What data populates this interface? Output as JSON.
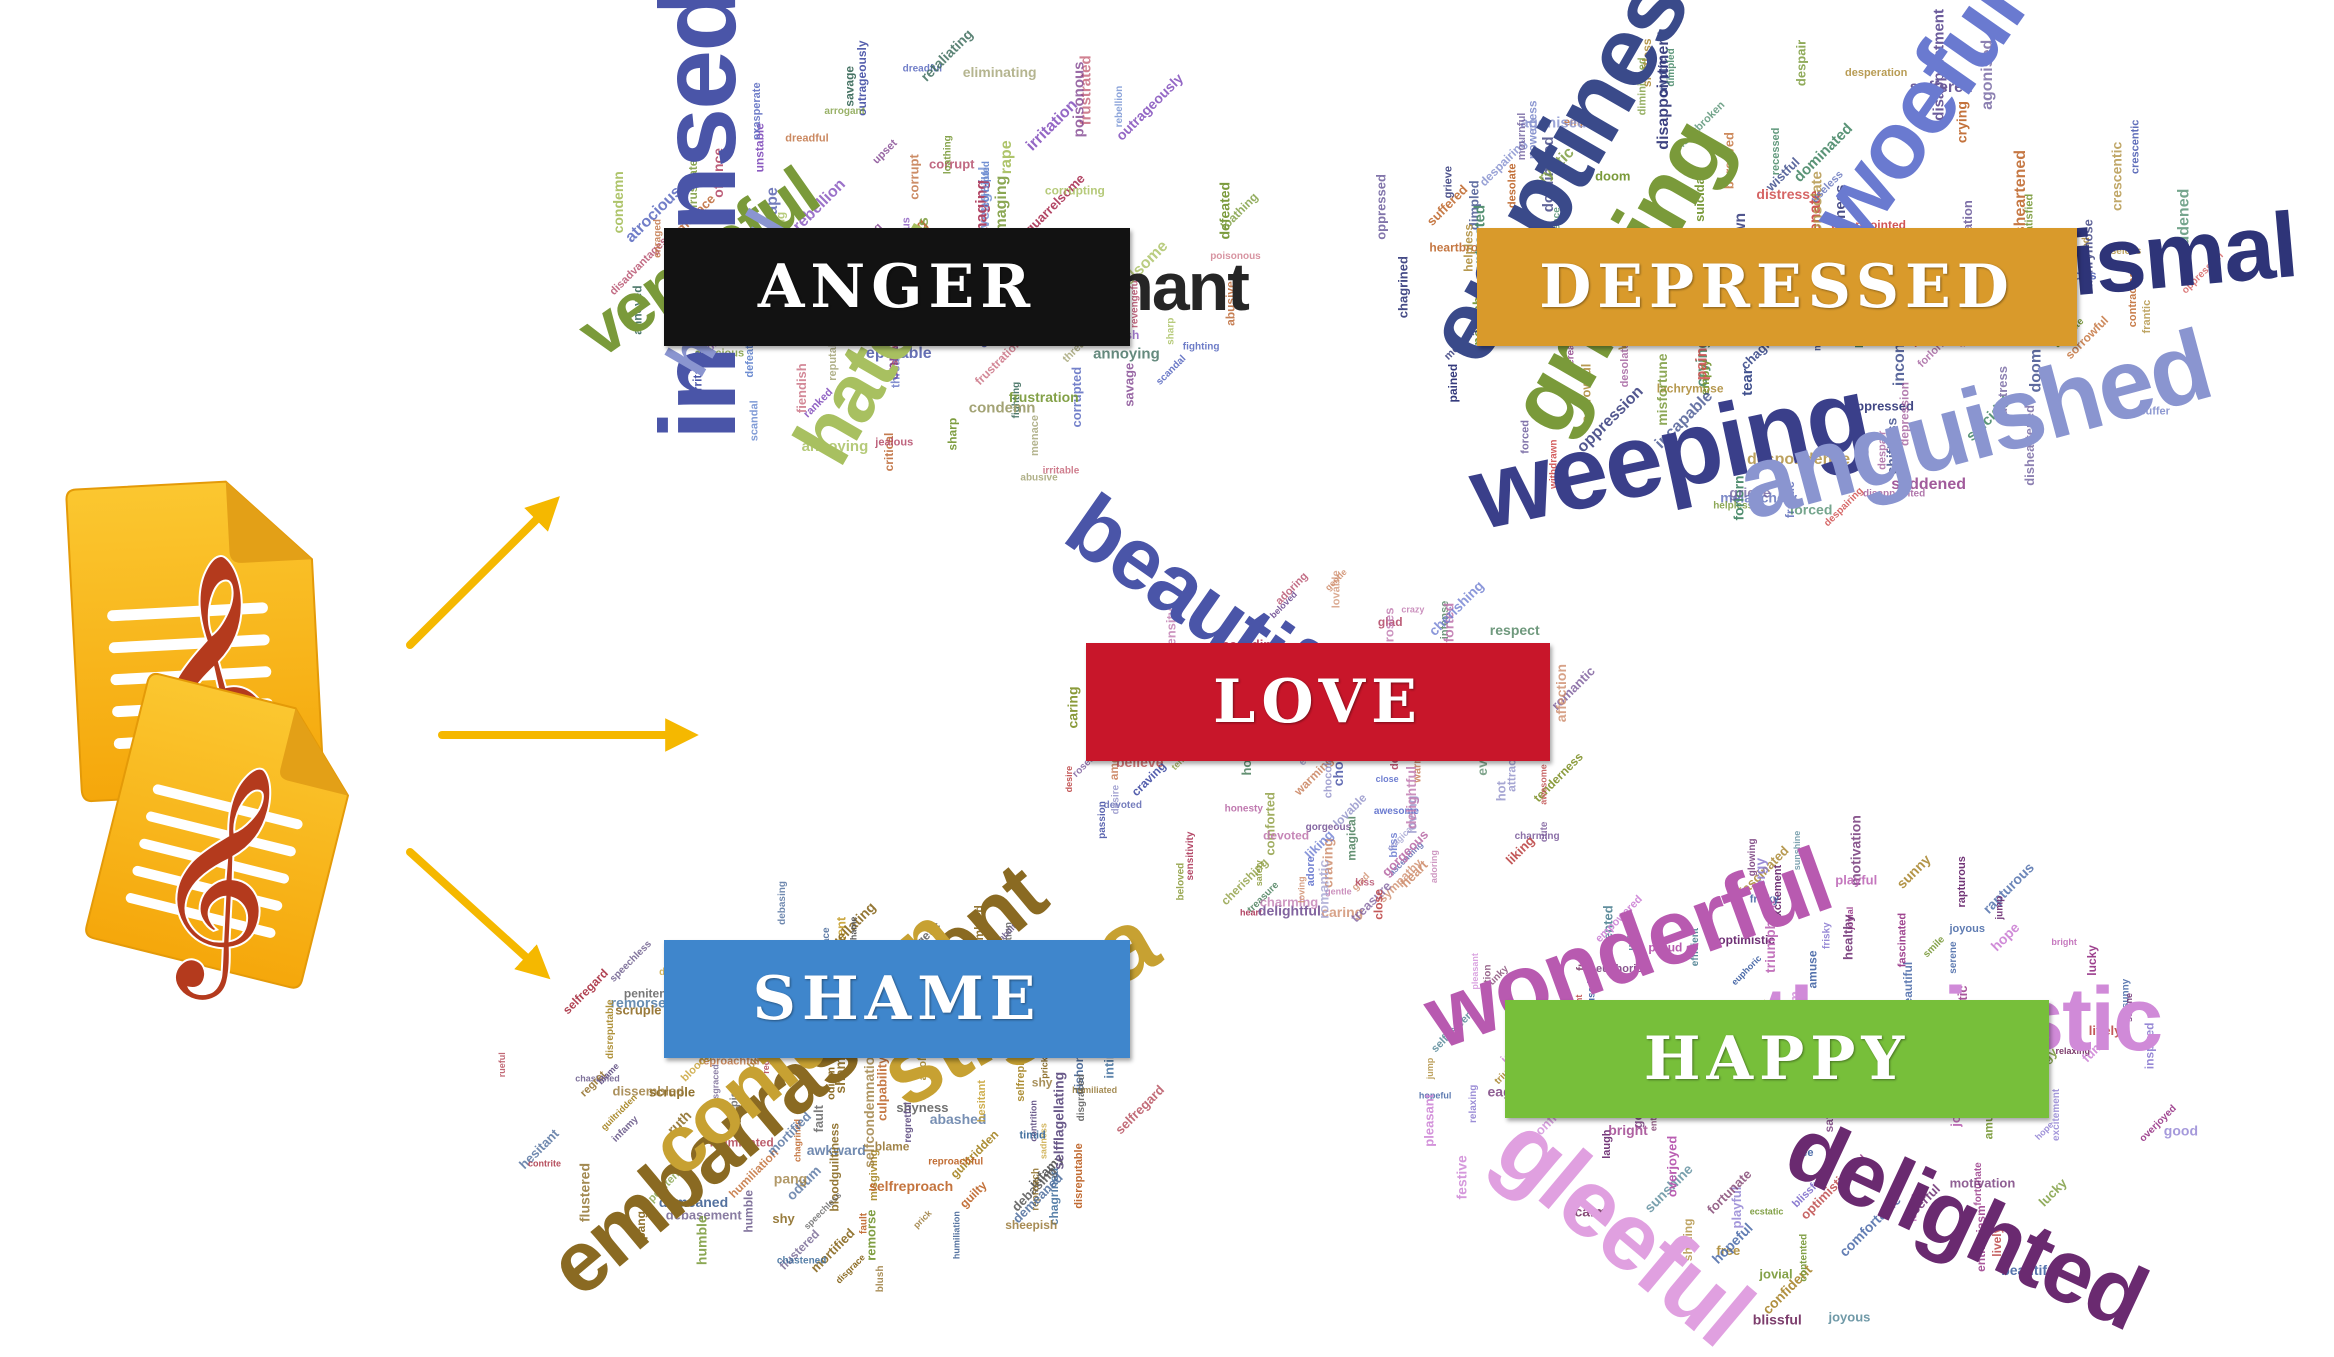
{
  "colors": {
    "arrow": "#f5b800",
    "anger": "#121212",
    "depressed": "#d99a2b",
    "love": "#c8162a",
    "shame": "#3f86cc",
    "happy": "#77bf3a",
    "file_body": "#f7b41a",
    "file_fold": "#e89e0c",
    "clef": "#b43a1d"
  },
  "icons": [
    "music-file-icon",
    "arrow-icon"
  ],
  "badges": {
    "anger": "ANGER",
    "depressed": "DEPRESSED",
    "love": "LOVE",
    "shame": "SHAME",
    "happy": "HAPPY"
  },
  "clouds": {
    "anger": {
      "big": [
        "incensed",
        "hateful",
        "vengeful",
        "indignant",
        "hurtful"
      ],
      "small": [
        "unstable",
        "revengeful",
        "corrupt",
        "critical",
        "dreadful",
        "irritable",
        "scandal",
        "annoyed",
        "atrocious",
        "bitterness",
        "frustrated",
        "fiendish",
        "reputable",
        "damaging",
        "upset",
        "threat",
        "disadvantages",
        "eliminating",
        "rebellion",
        "outrageously",
        "enraged",
        "rape",
        "offence",
        "sharp",
        "belligerent",
        "retaliating",
        "fighting",
        "quarrelsome",
        "corrupting",
        "ranked",
        "condemn",
        "annoying",
        "jealous",
        "exasperate",
        "arrogant",
        "corrupted",
        "defeated",
        "loathing",
        "irritation",
        "frustration",
        "abusive",
        "menace",
        "savage",
        "poisonous"
      ]
    },
    "depressed": {
      "big": [
        "emptiness",
        "weeping",
        "anguished",
        "grieving",
        "dismal",
        "woeful"
      ],
      "small": [
        "heartbroken",
        "empty",
        "pained",
        "forced",
        "suffer",
        "depression",
        "dissatisfied",
        "suicidal",
        "frantic",
        "inconsolable",
        "alienate",
        "disconsolate",
        "forlorn",
        "oppression",
        "tear",
        "agonised",
        "cryptic",
        "crying",
        "dominated",
        "despairing",
        "diminished",
        "despondence",
        "chagrined",
        "disheartened",
        "lachrymose",
        "melancholy",
        "wistful",
        "incapable",
        "disappointed",
        "despair",
        "distress",
        "disappointment",
        "recessed",
        "mortification",
        "dimpled",
        "crescentic",
        "oppressed",
        "contracted",
        "suffered",
        "shiftless",
        "useless",
        "powerless",
        "anxious",
        "bereaved",
        "misfortune",
        "helpless",
        "saddened",
        "doom",
        "desperation",
        "mournful",
        "withdrawn",
        "grieve",
        "sorrowful",
        "desolate",
        "dullness"
      ]
    },
    "love": {
      "big": [
        "beautiful"
      ],
      "small": [
        "treasure",
        "passion",
        "gentle",
        "adore",
        "crazy",
        "respect",
        "desire",
        "ascending",
        "warming",
        "gorgeous",
        "caring",
        "romance",
        "cute",
        "close",
        "romantic",
        "bliss",
        "blissful",
        "charming",
        "craving",
        "affection",
        "comforted",
        "delicate",
        "lovable",
        "magical",
        "intensity",
        "tenderness",
        "sensitivity",
        "attraction",
        "everlasting",
        "adoring",
        "joy",
        "amour",
        "heart",
        "hot",
        "glad",
        "loving",
        "roses",
        "safety",
        "beloved",
        "chocolate",
        "sympathy",
        "honesty",
        "intense",
        "cherishing",
        "liking",
        "believe",
        "devoted",
        "awesome",
        "delightful",
        "kiss"
      ]
    },
    "shame": {
      "big": [
        "embarrassment",
        "stigma",
        "confusion"
      ],
      "small": [
        "guiltridden",
        "contrition",
        "misgiving",
        "debasement",
        "culpability",
        "odium",
        "selfcondemnation",
        "disgrace",
        "shame",
        "reproach",
        "humiliated",
        "chagrined",
        "abashed",
        "sheepish",
        "sadness",
        "remorse",
        "regretful",
        "dishonor",
        "bloodguiltiness",
        "reticent",
        "scruple",
        "demeaned",
        "grief",
        "dissembled",
        "fault",
        "disgraced",
        "reproachful",
        "flustered",
        "selfflagellating",
        "selfreproach",
        "mortified",
        "debasing",
        "speechless",
        "awkward",
        "blush",
        "guilty",
        "prick",
        "shy",
        "pang",
        "chastened",
        "apologetic",
        "bloodguilt",
        "humble",
        "ruth",
        "rueful",
        "penitent",
        "disreputable",
        "contrite",
        "intimidated",
        "selfregard",
        "hesitant",
        "timid",
        "humiliation",
        "infamy",
        "blame",
        "regret",
        "shyness"
      ]
    },
    "happy": {
      "big": [
        "wonderful",
        "enthusiastic",
        "gleeful",
        "delighted"
      ],
      "small": [
        "joyous",
        "jovial",
        "satisfaction",
        "sunny",
        "good",
        "ecstatic",
        "eager",
        "rapturous",
        "free",
        "healthy",
        "cheerful",
        "jump",
        "triumphant",
        "serene",
        "optimistic",
        "relaxing",
        "spunky",
        "frisky",
        "motivation",
        "calm",
        "shining",
        "enthusiasm",
        "euphoric",
        "efficient",
        "amuse",
        "selfesteem",
        "inspired",
        "beautiful",
        "lively",
        "upbeat",
        "fascinated",
        "festive",
        "contented",
        "playful",
        "blissful",
        "excitement",
        "glowing",
        "fun",
        "joyful",
        "overjoyed",
        "empowered",
        "amused",
        "comfortable",
        "radiant",
        "bright",
        "confident",
        "pleasant",
        "proud",
        "fortunate",
        "sunshine",
        "energy",
        "laugh",
        "smile",
        "lucky",
        "hope",
        "hopeful"
      ]
    }
  }
}
